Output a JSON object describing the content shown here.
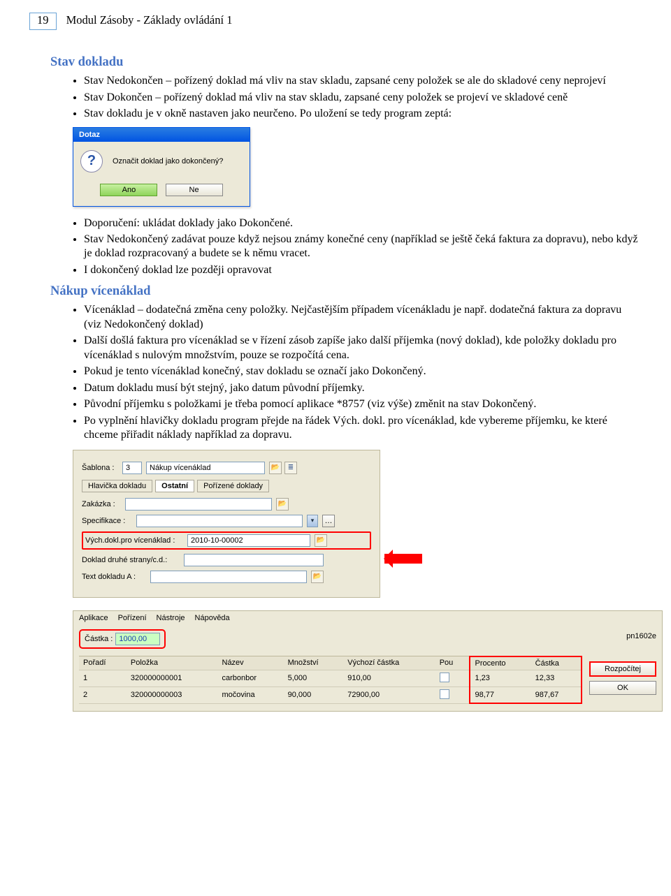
{
  "header": {
    "page_num": "19",
    "doc_title": "Modul Zásoby - Základy ovládání 1"
  },
  "section1": {
    "heading": "Stav dokladu",
    "bullets_a": [
      "Stav Nedokončen – pořízený doklad má vliv na stav skladu, zapsané ceny položek se ale do skladové ceny neprojeví",
      "Stav Dokončen – pořízený doklad má vliv na stav skladu, zapsané ceny položek se projeví ve skladové ceně",
      "Stav dokladu je v okně nastaven jako neurčeno. Po uložení se tedy program zeptá:"
    ],
    "dialog": {
      "title": "Dotaz",
      "message": "Označit doklad jako dokončený?",
      "yes": "Ano",
      "no": "Ne"
    },
    "bullets_b": [
      "Doporučení: ukládat doklady jako Dokončené.",
      "Stav Nedokončený zadávat pouze když nejsou známy konečné ceny (například se ještě čeká faktura za dopravu), nebo když je doklad rozpracovaný a budete se k němu vracet.",
      "I dokončený doklad lze později opravovat"
    ]
  },
  "section2": {
    "heading": "Nákup vícenáklad",
    "bullets": [
      "Vícenáklad – dodatečná změna ceny položky. Nejčastějším případem vícenákladu je např. dodatečná faktura za dopravu (viz Nedokončený doklad)",
      "Další došlá faktura pro vícenáklad se v řízení zásob zapíše jako další příjemka (nový doklad), kde položky dokladu pro vícenáklad s nulovým množstvím, pouze se rozpočítá cena.",
      "Pokud je tento vícenáklad konečný, stav dokladu se označí jako Dokončený.",
      "Datum dokladu musí být stejný, jako datum původní příjemky.",
      "Původní příjemku s položkami je třeba pomocí aplikace *8757 (viz výše) změnit na stav Dokončený.",
      "Po vyplnění hlavičky dokladu program přejde na řádek Vých. dokl. pro vícenáklad, kde vybereme příjemku, ke které chceme přiřadit náklady například za dopravu."
    ]
  },
  "form": {
    "sablona_label": "Šablona :",
    "sablona_value": "3",
    "sablona_name": "Nákup vícenáklad",
    "tab1": "Hlavička dokladu",
    "tab2": "Ostatní",
    "tab3": "Pořízené doklady",
    "zakazka_label": "Zakázka :",
    "zakazka_value": "",
    "spec_label": "Specifikace :",
    "spec_value": "",
    "vych_label": "Vých.dokl.pro vícenáklad :",
    "vych_value": "2010-10-00002",
    "druha_label": "Doklad druhé strany/c.d.:",
    "druha_value": "",
    "texta_label": "Text dokladu A :",
    "texta_value": ""
  },
  "grid": {
    "menu": [
      "Aplikace",
      "Pořízení",
      "Nástroje",
      "Nápověda"
    ],
    "castka_label": "Částka :",
    "castka_value": "1000,00",
    "code": "pn1602e",
    "headers": [
      "Pořadí",
      "Položka",
      "Název",
      "Množství",
      "Výchozí částka",
      "Pou",
      "Procento",
      "Částka"
    ],
    "rows": [
      {
        "poradi": "1",
        "polozka": "320000000001",
        "nazev": "carbonbor",
        "mnozstvi": "5,000",
        "vychozi": "910,00",
        "procento": "1,23",
        "castka": "12,33"
      },
      {
        "poradi": "2",
        "polozka": "320000000003",
        "nazev": "močovina",
        "mnozstvi": "90,000",
        "vychozi": "72900,00",
        "procento": "98,77",
        "castka": "987,67"
      }
    ],
    "btn_rozpocitej": "Rozpočítej",
    "btn_ok": "OK"
  }
}
